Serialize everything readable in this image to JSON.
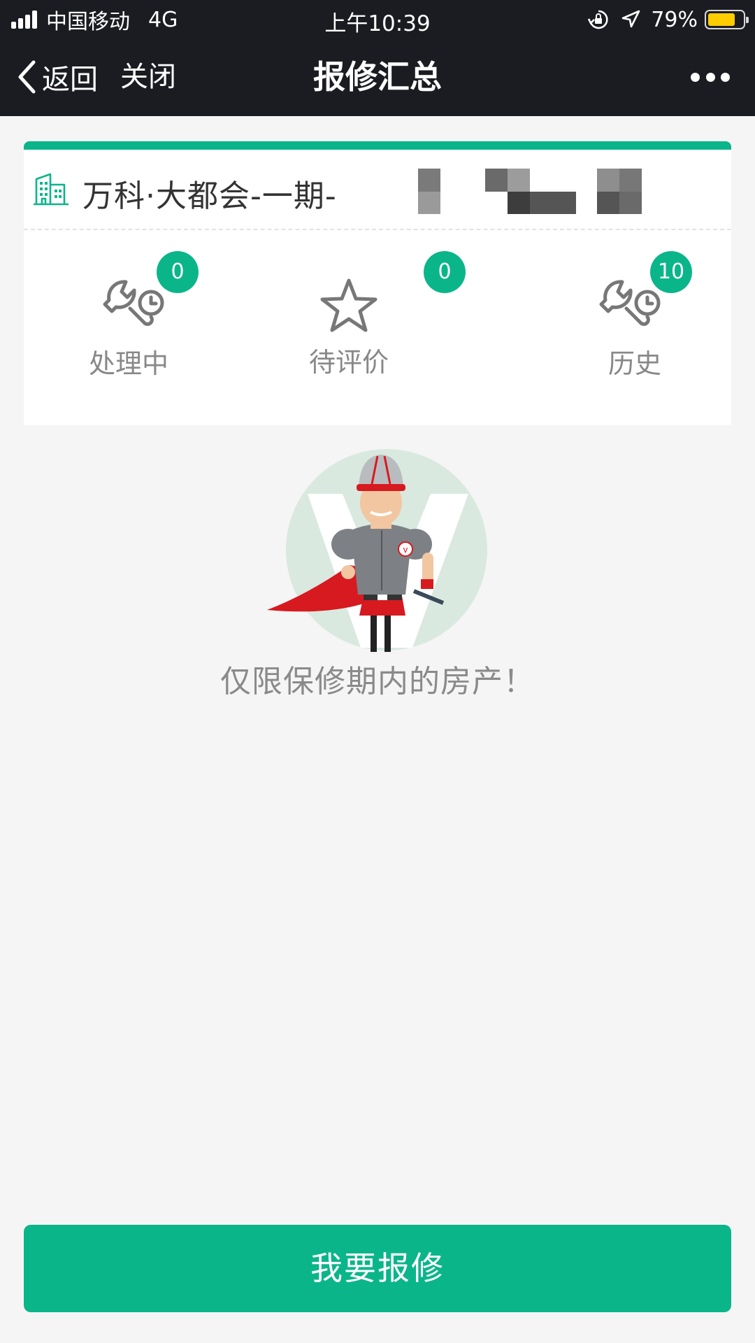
{
  "status_bar": {
    "carrier": "中国移动",
    "network": "4G",
    "time": "上午10:39",
    "battery_percent": "79%",
    "battery_level": 0.79
  },
  "nav": {
    "back_label": "返回",
    "close_label": "关闭",
    "title": "报修汇总"
  },
  "property": {
    "name": "万科·大都会-一期-"
  },
  "stats": [
    {
      "label": "处理中",
      "count": "0",
      "icon": "wrench-clock-icon"
    },
    {
      "label": "待评价",
      "count": "0",
      "icon": "star-icon"
    },
    {
      "label": "历史",
      "count": "10",
      "icon": "wrench-clock-icon"
    }
  ],
  "notice": "仅限保修期内的房产！",
  "repair_button": "我要报修",
  "colors": {
    "accent": "#0bb58a",
    "header": "#1b1c21",
    "background": "#f5f5f5"
  }
}
